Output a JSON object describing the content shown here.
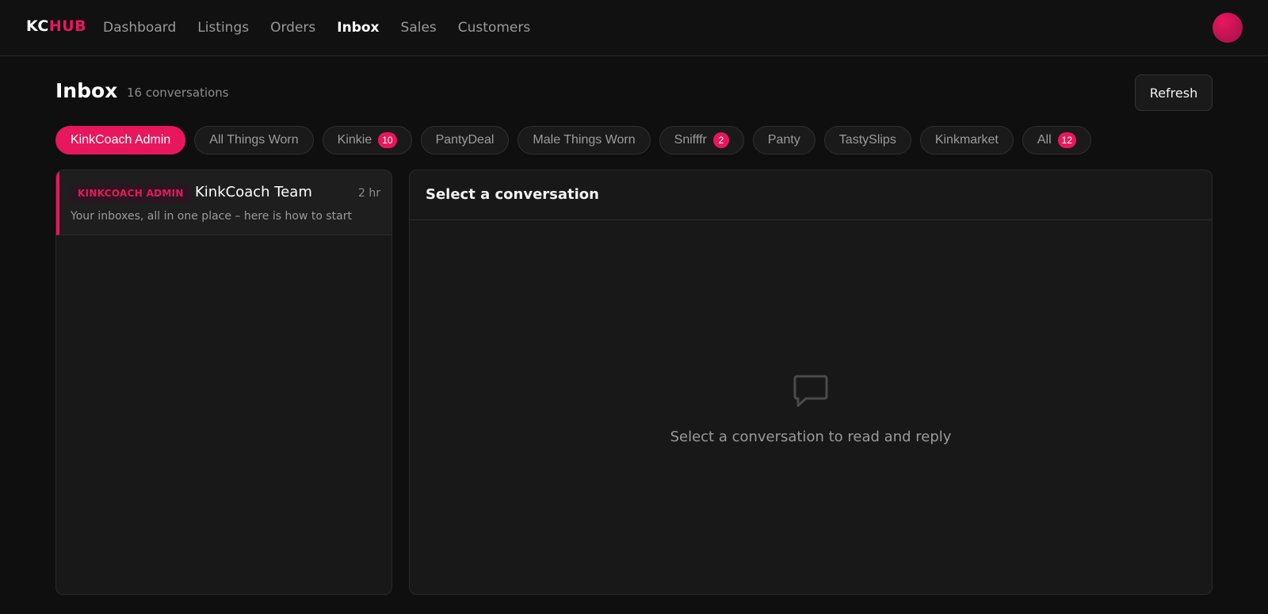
{
  "logo": {
    "part1": "KC",
    "part2": "HUB"
  },
  "nav": {
    "items": [
      {
        "label": "Dashboard"
      },
      {
        "label": "Listings"
      },
      {
        "label": "Orders"
      },
      {
        "label": "Inbox",
        "active": true
      },
      {
        "label": "Sales"
      },
      {
        "label": "Customers"
      }
    ]
  },
  "header": {
    "title": "Inbox",
    "count": "16 conversations",
    "refresh_label": "Refresh"
  },
  "filters": [
    {
      "label": "KinkCoach Admin",
      "active": true,
      "badge": ""
    },
    {
      "label": "All Things Worn",
      "badge": ""
    },
    {
      "label": "Kinkie",
      "badge": "10"
    },
    {
      "label": "PantyDeal",
      "badge": ""
    },
    {
      "label": "Male Things Worn",
      "badge": ""
    },
    {
      "label": "Snifffr",
      "badge": "2"
    },
    {
      "label": "Panty",
      "badge": ""
    },
    {
      "label": "TastySlips",
      "badge": ""
    },
    {
      "label": "Kinkmarket",
      "badge": ""
    },
    {
      "label": "All",
      "badge": "12"
    }
  ],
  "conversations": [
    {
      "source": "KINKCOACH ADMIN",
      "sender": "KinkCoach Team",
      "time": "2 hr",
      "preview": "Your inboxes, all in one place – here is how to start"
    }
  ],
  "detail": {
    "title": "Select a conversation",
    "empty_icon": "chat-bubble-icon",
    "empty_text": "Select a conversation to read and reply"
  },
  "colors": {
    "accent": "#e8175d",
    "background": "#0f0f0f",
    "panel": "#181818"
  }
}
